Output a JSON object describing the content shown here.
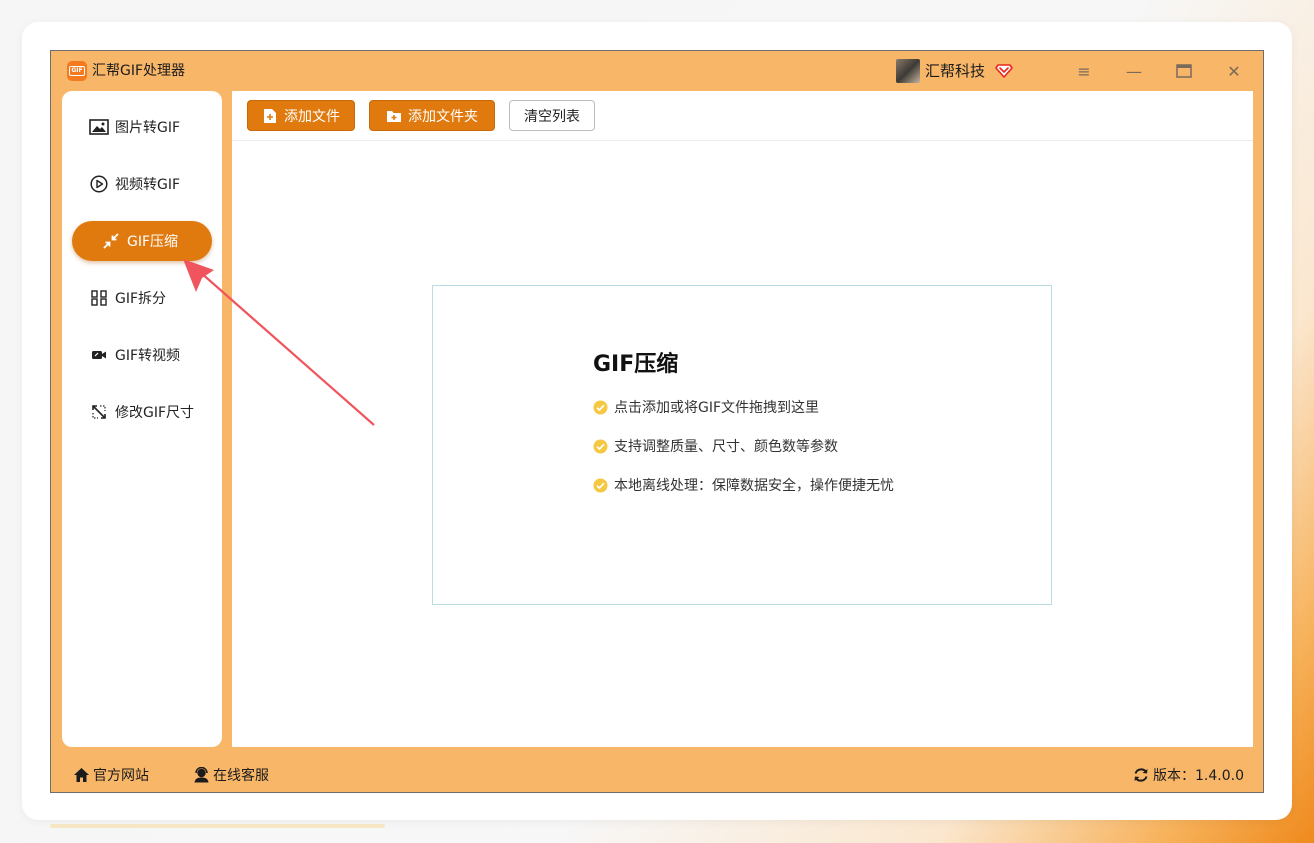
{
  "app": {
    "title": "汇帮GIF处理器",
    "logo_text": "GIF",
    "user_name": "汇帮科技",
    "accent_color": "#e07a0e",
    "frame_color": "#f8b668"
  },
  "window_controls": {
    "menu_glyph": "≡",
    "minimize_glyph": "—",
    "maximize_glyph": "▭",
    "close_glyph": "✕"
  },
  "sidebar": {
    "items": [
      {
        "label": "图片转GIF",
        "icon": "image-icon",
        "active": false
      },
      {
        "label": "视频转GIF",
        "icon": "play-circle-icon",
        "active": false
      },
      {
        "label": "GIF压缩",
        "icon": "compress-arrows-icon",
        "active": true
      },
      {
        "label": "GIF拆分",
        "icon": "split-grid-icon",
        "active": false
      },
      {
        "label": "GIF转视频",
        "icon": "video-camera-icon",
        "active": false
      },
      {
        "label": "修改GIF尺寸",
        "icon": "resize-icon",
        "active": false
      }
    ]
  },
  "toolbar": {
    "add_file_label": "添加文件",
    "add_folder_label": "添加文件夹",
    "clear_list_label": "清空列表"
  },
  "dropzone": {
    "title": "GIF压缩",
    "lines": [
      "点击添加或将GIF文件拖拽到这里",
      "支持调整质量、尺寸、颜色数等参数",
      "本地离线处理：保障数据安全，操作便捷无忧"
    ]
  },
  "footer": {
    "website_label": "官方网站",
    "support_label": "在线客服",
    "version_label": "版本：1.4.0.0"
  }
}
